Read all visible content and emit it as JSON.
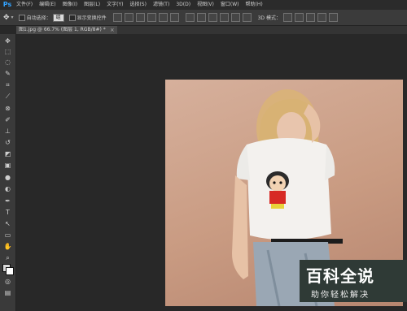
{
  "menu": {
    "logo": "Ps",
    "items": [
      "文件(F)",
      "编辑(E)",
      "图像(I)",
      "图层(L)",
      "文字(Y)",
      "选择(S)",
      "滤镜(T)",
      "3D(D)",
      "视图(V)",
      "窗口(W)",
      "帮助(H)"
    ]
  },
  "options": {
    "auto_select_label": "自动选择：",
    "auto_select_value": "组",
    "transform_controls_label": "显示变换控件",
    "mode_3d_label": "3D 模式："
  },
  "document_tab": {
    "title": "图1.jpg @ 66.7% (图层 1, RGB/8#) *",
    "close": "×"
  },
  "tools": [
    "move-tool",
    "marquee-tool",
    "lasso-tool",
    "quick-select-tool",
    "crop-tool",
    "eyedropper-tool",
    "healing-tool",
    "brush-tool",
    "stamp-tool",
    "history-brush-tool",
    "eraser-tool",
    "gradient-tool",
    "blur-tool",
    "dodge-tool",
    "pen-tool",
    "type-tool",
    "path-select-tool",
    "shape-tool",
    "hand-tool",
    "zoom-tool"
  ],
  "watermark": {
    "title": "百科全说",
    "subtitle": "助你轻松解决"
  }
}
